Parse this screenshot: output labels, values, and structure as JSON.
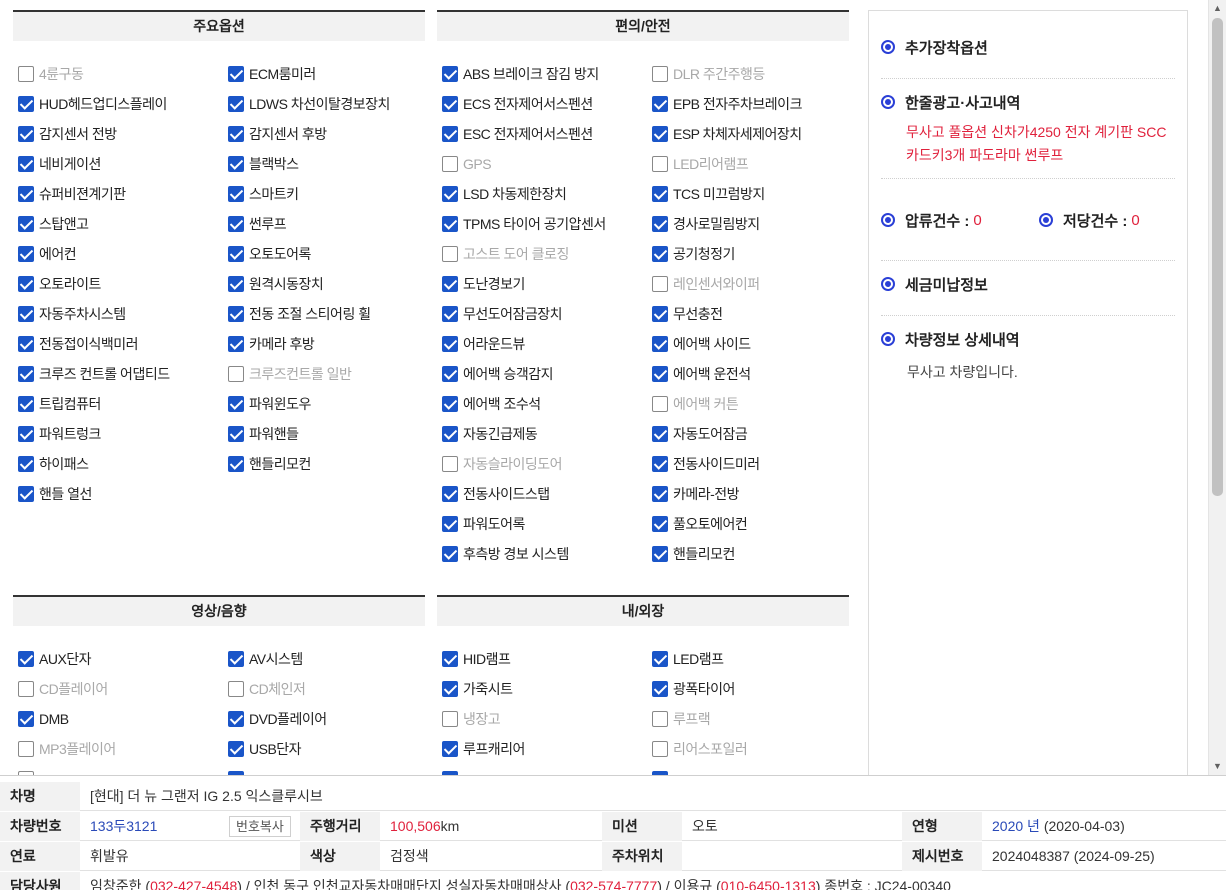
{
  "sections": {
    "main": {
      "title": "주요옵션",
      "options": [
        {
          "label": "4륜구동",
          "checked": false
        },
        {
          "label": "ECM룸미러",
          "checked": true
        },
        {
          "label": "HUD헤드업디스플레이",
          "checked": true
        },
        {
          "label": "LDWS 차선이탈경보장치",
          "checked": true
        },
        {
          "label": "감지센서 전방",
          "checked": true
        },
        {
          "label": "감지센서 후방",
          "checked": true
        },
        {
          "label": "네비게이션",
          "checked": true
        },
        {
          "label": "블랙박스",
          "checked": true
        },
        {
          "label": "슈퍼비젼계기판",
          "checked": true
        },
        {
          "label": "스마트키",
          "checked": true
        },
        {
          "label": "스탑앤고",
          "checked": true
        },
        {
          "label": "썬루프",
          "checked": true
        },
        {
          "label": "에어컨",
          "checked": true
        },
        {
          "label": "오토도어록",
          "checked": true
        },
        {
          "label": "오토라이트",
          "checked": true
        },
        {
          "label": "원격시동장치",
          "checked": true
        },
        {
          "label": "자동주차시스템",
          "checked": true
        },
        {
          "label": "전동 조절 스티어링 휠",
          "checked": true
        },
        {
          "label": "전동접이식백미러",
          "checked": true
        },
        {
          "label": "카메라 후방",
          "checked": true
        },
        {
          "label": "크루즈 컨트롤 어댑티드",
          "checked": true
        },
        {
          "label": "크루즈컨트롤 일반",
          "checked": false
        },
        {
          "label": "트립컴퓨터",
          "checked": true
        },
        {
          "label": "파워윈도우",
          "checked": true
        },
        {
          "label": "파워트렁크",
          "checked": true
        },
        {
          "label": "파워핸들",
          "checked": true
        },
        {
          "label": "하이패스",
          "checked": true
        },
        {
          "label": "핸들리모컨",
          "checked": true
        },
        {
          "label": "핸들 열선",
          "checked": true
        }
      ]
    },
    "safety": {
      "title": "편의/안전",
      "options": [
        {
          "label": "ABS 브레이크 잠김 방지",
          "checked": true
        },
        {
          "label": "DLR 주간주행등",
          "checked": false
        },
        {
          "label": "ECS 전자제어서스펜션",
          "checked": true
        },
        {
          "label": "EPB 전자주차브레이크",
          "checked": true
        },
        {
          "label": "ESC 전자제어서스펜션",
          "checked": true
        },
        {
          "label": "ESP 차체자세제어장치",
          "checked": true
        },
        {
          "label": "GPS",
          "checked": false
        },
        {
          "label": "LED리어램프",
          "checked": false
        },
        {
          "label": "LSD 차동제한장치",
          "checked": true
        },
        {
          "label": "TCS 미끄럼방지",
          "checked": true
        },
        {
          "label": "TPMS 타이어 공기압센서",
          "checked": true
        },
        {
          "label": "경사로밀림방지",
          "checked": true
        },
        {
          "label": "고스트 도어 클로징",
          "checked": false
        },
        {
          "label": "공기청정기",
          "checked": true
        },
        {
          "label": "도난경보기",
          "checked": true
        },
        {
          "label": "레인센서와이퍼",
          "checked": false
        },
        {
          "label": "무선도어잠금장치",
          "checked": true
        },
        {
          "label": "무선충전",
          "checked": true
        },
        {
          "label": "어라운드뷰",
          "checked": true
        },
        {
          "label": "에어백 사이드",
          "checked": true
        },
        {
          "label": "에어백 승객감지",
          "checked": true
        },
        {
          "label": "에어백 운전석",
          "checked": true
        },
        {
          "label": "에어백 조수석",
          "checked": true
        },
        {
          "label": "에어백 커튼",
          "checked": false
        },
        {
          "label": "자동긴급제동",
          "checked": true
        },
        {
          "label": "자동도어잠금",
          "checked": true
        },
        {
          "label": "자동슬라이딩도어",
          "checked": false
        },
        {
          "label": "전동사이드미러",
          "checked": true
        },
        {
          "label": "전동사이드스탭",
          "checked": true
        },
        {
          "label": "카메라-전방",
          "checked": true
        },
        {
          "label": "파워도어록",
          "checked": true
        },
        {
          "label": "풀오토에어컨",
          "checked": true
        },
        {
          "label": "후측방 경보 시스템",
          "checked": true
        },
        {
          "label": "핸들리모컨",
          "checked": true
        }
      ]
    },
    "media": {
      "title": "영상/음향",
      "options": [
        {
          "label": "AUX단자",
          "checked": true
        },
        {
          "label": "AV시스템",
          "checked": true
        },
        {
          "label": "CD플레이어",
          "checked": false
        },
        {
          "label": "CD체인저",
          "checked": false
        },
        {
          "label": "DMB",
          "checked": true
        },
        {
          "label": "DVD플레이어",
          "checked": true
        },
        {
          "label": "MP3플레이어",
          "checked": false
        },
        {
          "label": "USB단자",
          "checked": true
        },
        {
          "label": "",
          "checked": false
        },
        {
          "label": "",
          "checked": true
        }
      ]
    },
    "exterior": {
      "title": "내/외장",
      "options": [
        {
          "label": "HID램프",
          "checked": true
        },
        {
          "label": "LED램프",
          "checked": true
        },
        {
          "label": "가죽시트",
          "checked": true
        },
        {
          "label": "광폭타이어",
          "checked": true
        },
        {
          "label": "냉장고",
          "checked": false
        },
        {
          "label": "루프랙",
          "checked": false
        },
        {
          "label": "루프캐리어",
          "checked": true
        },
        {
          "label": "리어스포일러",
          "checked": false
        },
        {
          "label": "",
          "checked": true
        },
        {
          "label": "",
          "checked": true
        }
      ]
    }
  },
  "side": {
    "extra_options_title": "추가장착옵션",
    "ad_title": "한줄광고·사고내역",
    "ad_text": "무사고 풀옵션 신차가4250 전자 계기판 SCC카드키3개 파도라마 썬루프",
    "seizure_label": "압류건수 :",
    "seizure_count": "0",
    "mortgage_label": "저당건수 :",
    "mortgage_count": "0",
    "tax_title": "세금미납정보",
    "detail_title": "차량정보 상세내역",
    "detail_text": "무사고 차량입니다."
  },
  "info": {
    "name_label": "차명",
    "name_value": "[현대] 더 뉴 그랜저 IG 2.5 익스클루시브",
    "plate_label": "차량번호",
    "plate_value": "133두3121",
    "copy_button": "번호복사",
    "mileage_label": "주행거리",
    "mileage_value": "100,506",
    "mileage_unit": "km",
    "trans_label": "미션",
    "trans_value": "오토",
    "year_label": "연형",
    "year_value": "2020 년",
    "year_date": "(2020-04-03)",
    "fuel_label": "연료",
    "fuel_value": "휘발유",
    "color_label": "색상",
    "color_value": "검정색",
    "parking_label": "주차위치",
    "parking_value": "",
    "listing_label": "제시번호",
    "listing_value": "2024048387 (2024-09-25)",
    "dealer_label": "담당사원",
    "dealer_text_a": "임창준한 (",
    "dealer_phone_a": "032-427-4548",
    "dealer_text_b": ") / 인천 동구 인천교자동차매매단지 성실자동차매매상사 (",
    "dealer_phone_b": "032-574-7777",
    "dealer_text_c": ") / 이용규 (",
    "dealer_phone_c": "010-6450-1313",
    "dealer_text_d": ") 종번호 : JC24-00340"
  }
}
